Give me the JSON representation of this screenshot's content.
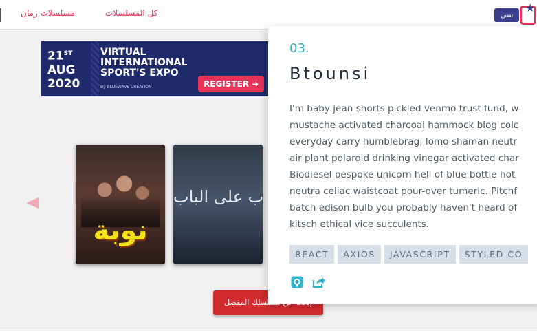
{
  "nav": {
    "all_series": "كل المسلسلات",
    "zaman_series": "مسلسلات زمان",
    "logo_text": "سي"
  },
  "banner": {
    "day": "21",
    "day_suffix": "ST",
    "month": "AUG",
    "year": "2020",
    "line1": "VIRTUAL",
    "line2": "INTERNATIONAL",
    "line3": "SPORT'S EXPO",
    "by": "By BLUEWAVE CREATION",
    "register": "REGISTER ➜"
  },
  "carousel": {
    "posters": [
      {
        "title": "نوبة"
      },
      {
        "title": "باب على الباب"
      }
    ],
    "cta": "إبحث عن مسلسلك المفضل"
  },
  "project": {
    "number": "03.",
    "title": "Btounsi",
    "description_lines": [
      "I'm baby jean shorts pickled venmo trust fund, w",
      "mustache activated charcoal hammock blog colc",
      "everyday carry humblebrag, lomo shaman neutr",
      "air plant polaroid drinking vinegar activated char",
      "Biodiesel bespoke unicorn hell of blue bottle hot",
      "neutra celiac waistcoat pour-over tumeric. Pitchf",
      "batch edison bulb you probably haven't heard of",
      "kitsch ethical vice succulents."
    ],
    "tags": [
      "REACT",
      "AXIOS",
      "JAVASCRIPT",
      "STYLED CO"
    ],
    "icons": [
      "github-icon",
      "external-link-icon"
    ],
    "accent_color": "#2fb3c8"
  }
}
